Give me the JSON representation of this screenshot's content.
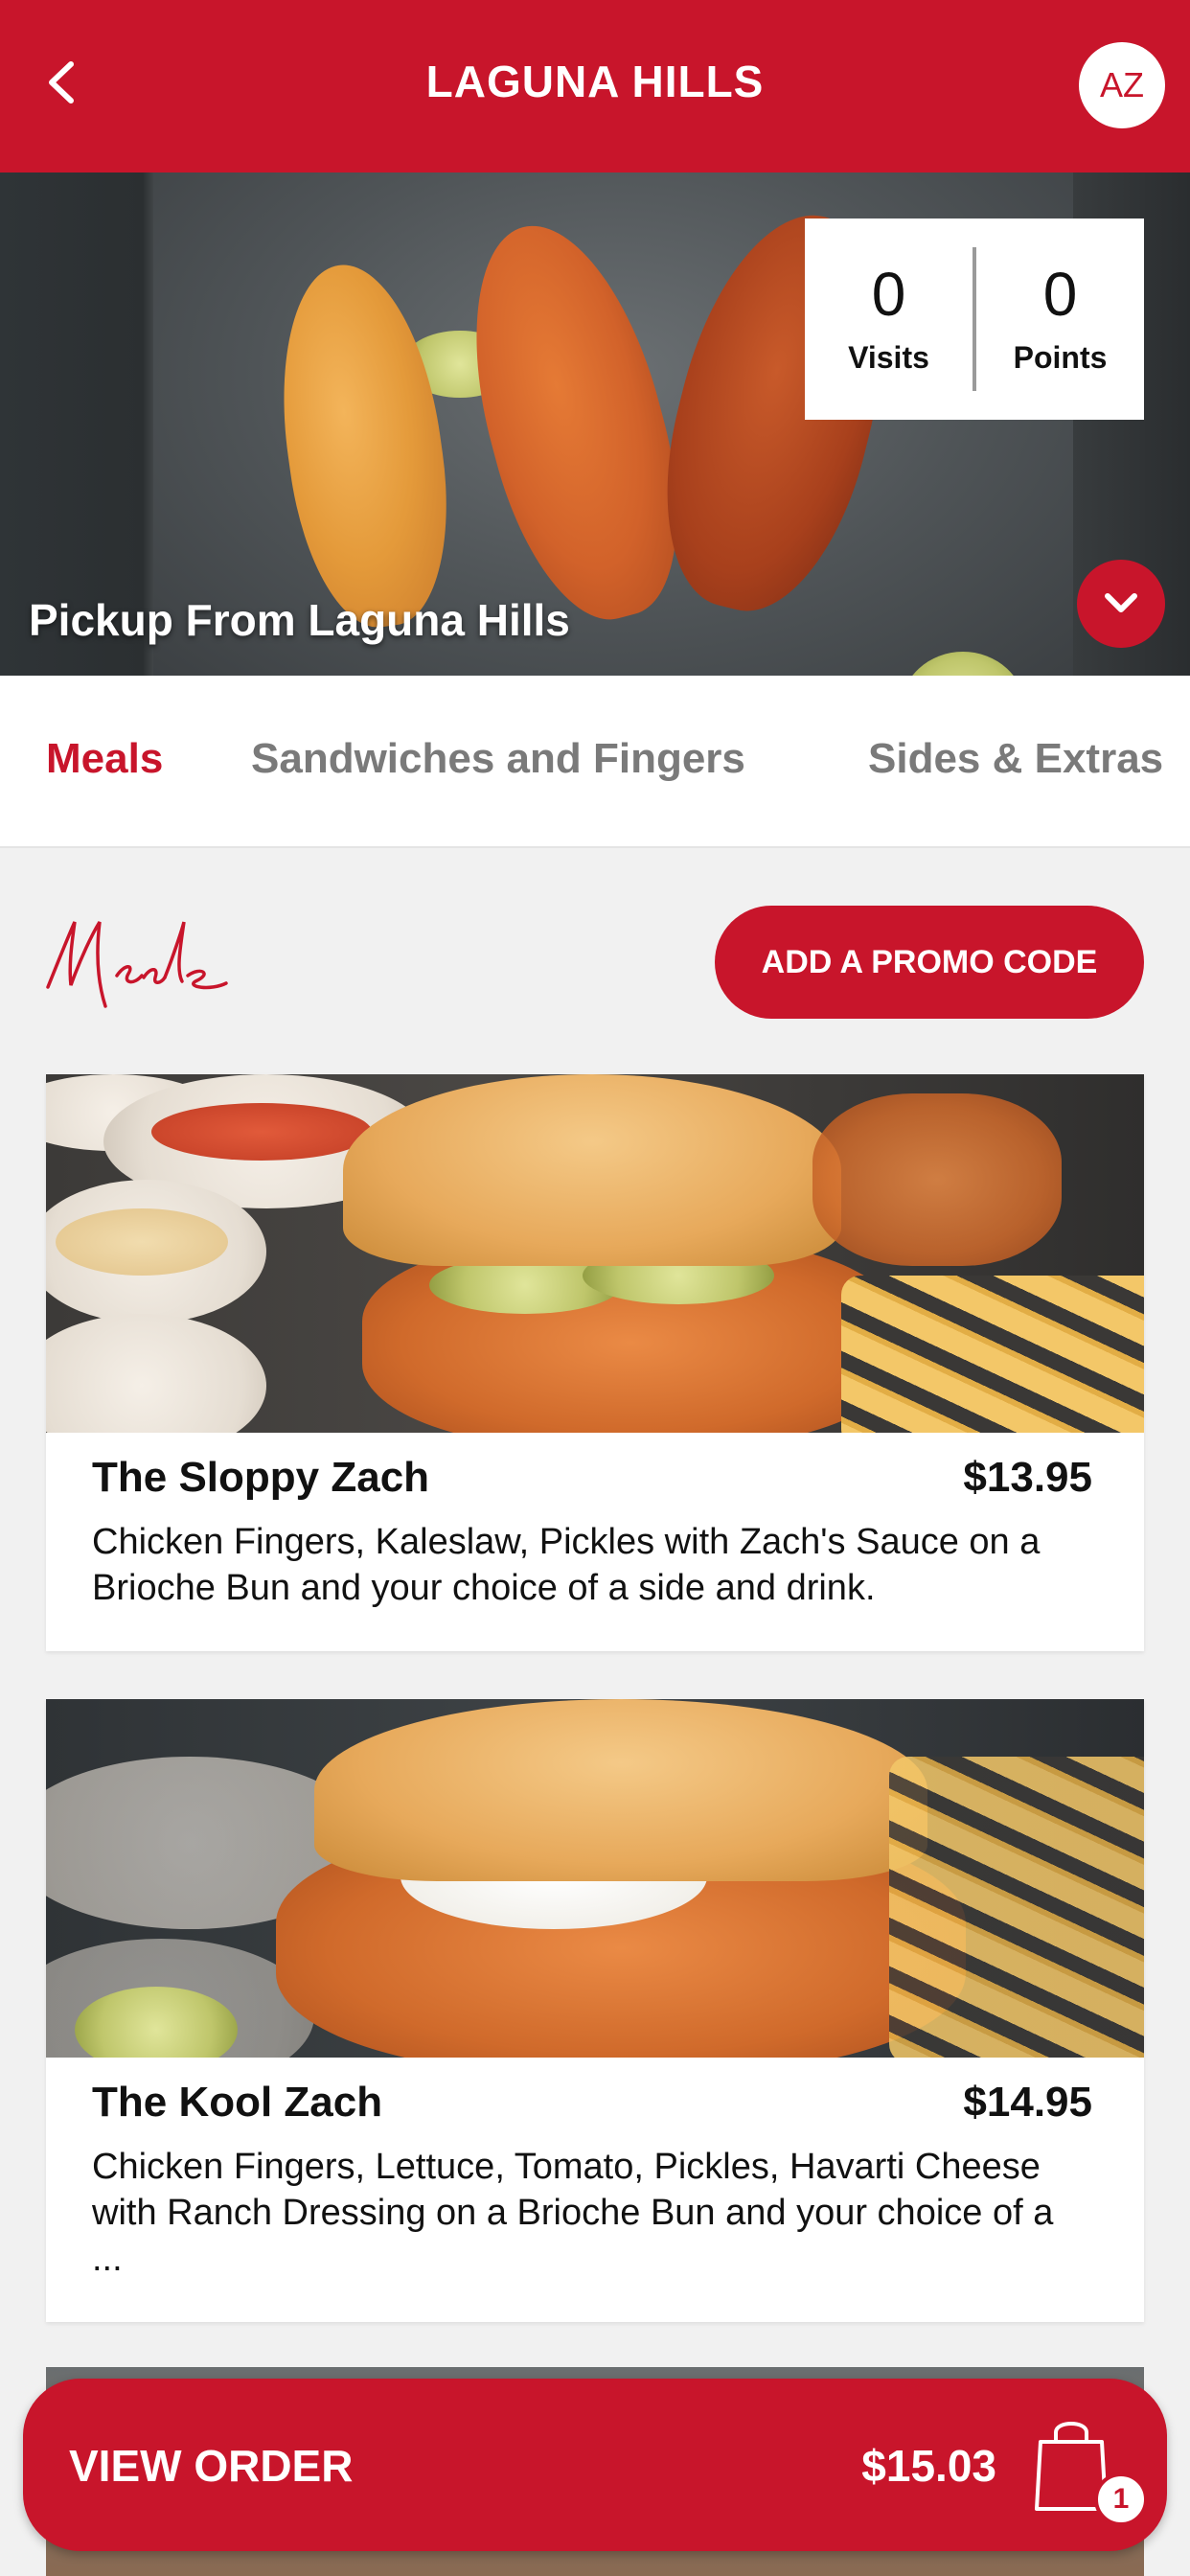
{
  "header": {
    "title": "LAGUNA HILLS",
    "avatar_initials": "AZ"
  },
  "hero": {
    "visits_value": "0",
    "visits_label": "Visits",
    "points_value": "0",
    "points_label": "Points",
    "pickup_text": "Pickup From Laguna Hills"
  },
  "tabs": [
    {
      "label": "Meals",
      "active": true
    },
    {
      "label": "Sandwiches and Fingers",
      "active": false
    },
    {
      "label": "Sides & Extras",
      "active": false
    }
  ],
  "section": {
    "title": "Meals",
    "promo_label": "ADD A PROMO CODE"
  },
  "items": [
    {
      "name": "The Sloppy Zach",
      "price": "$13.95",
      "description": "Chicken Fingers, Kaleslaw, Pickles with Zach's Sauce on a Brioche Bun and your choice of a side and drink."
    },
    {
      "name": "The Kool Zach",
      "price": "$14.95",
      "description": "Chicken Fingers, Lettuce, Tomato, Pickles, Havarti Cheese with Ranch Dressing on a Brioche Bun and your choice of a ..."
    }
  ],
  "order": {
    "label": "VIEW ORDER",
    "total": "$15.03",
    "count": "1"
  },
  "colors": {
    "brand_red": "#c8152b"
  }
}
